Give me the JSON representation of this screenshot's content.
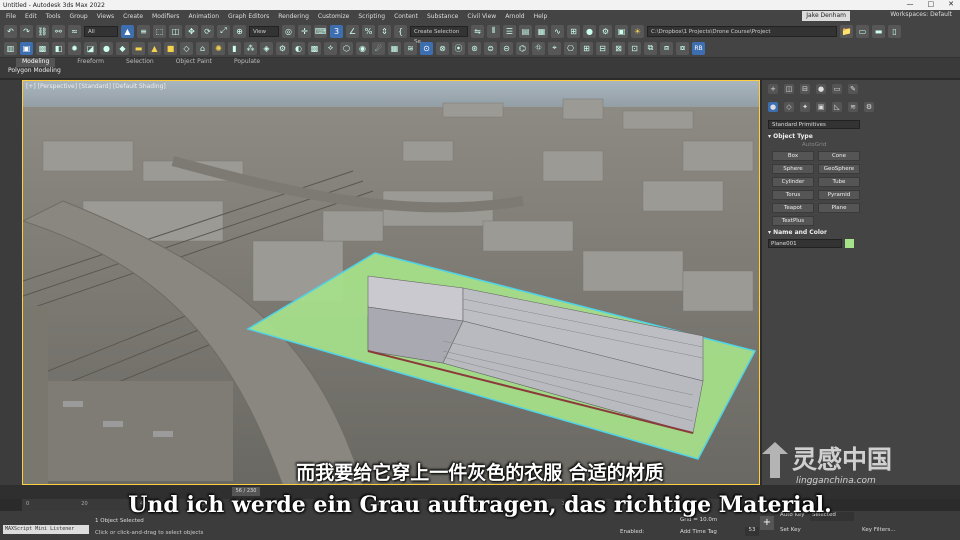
{
  "window": {
    "title": "Untitled - Autodesk 3ds Max 2022",
    "controls": [
      "—",
      "□",
      "✕"
    ]
  },
  "menu": {
    "items": [
      "File",
      "Edit",
      "Tools",
      "Group",
      "Views",
      "Create",
      "Modifiers",
      "Animation",
      "Graph Editors",
      "Rendering",
      "Customize",
      "Scripting",
      "Content",
      "Substance",
      "Civil View",
      "Arnold",
      "Help"
    ],
    "user": "Jake Denham",
    "workspace_label": "Workspaces:",
    "workspace_value": "Default"
  },
  "toolbar": {
    "filter_value": "All",
    "view_value": "View",
    "selection_set_placeholder": "Create Selection Se",
    "project_path": "C:\\Dropbox\\1 Projects\\Drone Course\\Project",
    "rb_label": "RB"
  },
  "ribbon": {
    "tabs": [
      "Modeling",
      "Freeform",
      "Selection",
      "Object Paint",
      "Populate"
    ],
    "sub_label": "Polygon Modeling"
  },
  "viewport": {
    "label": "[+] [Perspective] [Standard] [Default Shading]"
  },
  "command_panel": {
    "dropdown_value": "Standard Primitives",
    "object_type_header": "Object Type",
    "autogrid_label": "AutoGrid",
    "buttons": [
      "Box",
      "Cone",
      "Sphere",
      "GeoSphere",
      "Cylinder",
      "Tube",
      "Torus",
      "Pyramid",
      "Teapot",
      "Plane",
      "TextPlus"
    ],
    "name_color_header": "Name and Color",
    "object_name": "Plane001",
    "object_color": "#a6e28a"
  },
  "timeline": {
    "frame_label": "56 / 230",
    "ticks": [
      "0",
      "10",
      "20",
      "30",
      "40",
      "50",
      "60",
      "70",
      "80",
      "90",
      "100",
      "110",
      "120",
      "130",
      "140",
      "150",
      "160",
      "170",
      "180",
      "190",
      "200",
      "210",
      "220",
      "230"
    ]
  },
  "status": {
    "maxscript_label": "MAXScript Mini Listener",
    "selection_text": "1 Object Selected",
    "prompt_text": "Click or click-and-drag to select objects",
    "enabled_label": "Enabled:",
    "add_time_tag": "Add Time Tag",
    "grid_label": "Grid = 10.0m",
    "auto_key_label": "Auto Key",
    "set_key_label": "Set Key",
    "key_mode_value": "Selected",
    "key_filters_label": "Key Filters...",
    "frame_value": "53"
  },
  "subtitles": {
    "chinese": "而我要给它穿上一件灰色的衣服 合适的材质",
    "german": "Und ich werde ein Grau auftragen, das richtige Material."
  },
  "watermark": {
    "chinese": "灵感中国",
    "english": "lingganchina.com"
  }
}
